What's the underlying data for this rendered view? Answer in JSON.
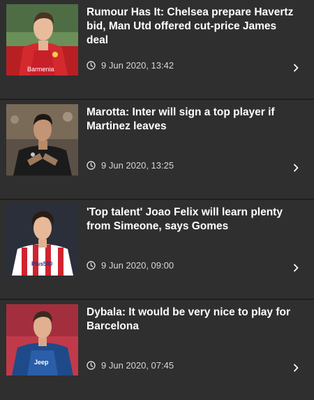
{
  "articles": [
    {
      "headline": "Rumour Has It: Chelsea prepare Havertz bid, Man Utd offered cut-price James deal",
      "timestamp": "9 Jun 2020, 13:42",
      "image_icon": "player-photo-havertz",
      "kit_text": "Barmenia"
    },
    {
      "headline": "Marotta: Inter will sign a top player if Martinez leaves",
      "timestamp": "9 Jun 2020, 13:25",
      "image_icon": "player-photo-martinez"
    },
    {
      "headline": "'Top talent' Joao Felix will learn plenty from Simeone, says Gomes",
      "timestamp": "9 Jun 2020, 09:00",
      "image_icon": "player-photo-felix",
      "kit_text": "Plus500"
    },
    {
      "headline": "Dybala: It would be very nice to play for Barcelona",
      "timestamp": "9 Jun 2020, 07:45",
      "image_icon": "player-photo-dybala",
      "kit_text": "Jeep"
    }
  ],
  "colors": {
    "background": "#2f2f2f",
    "divider": "#1f1f1f",
    "headline": "#ffffff",
    "meta": "#d6d6d6"
  }
}
